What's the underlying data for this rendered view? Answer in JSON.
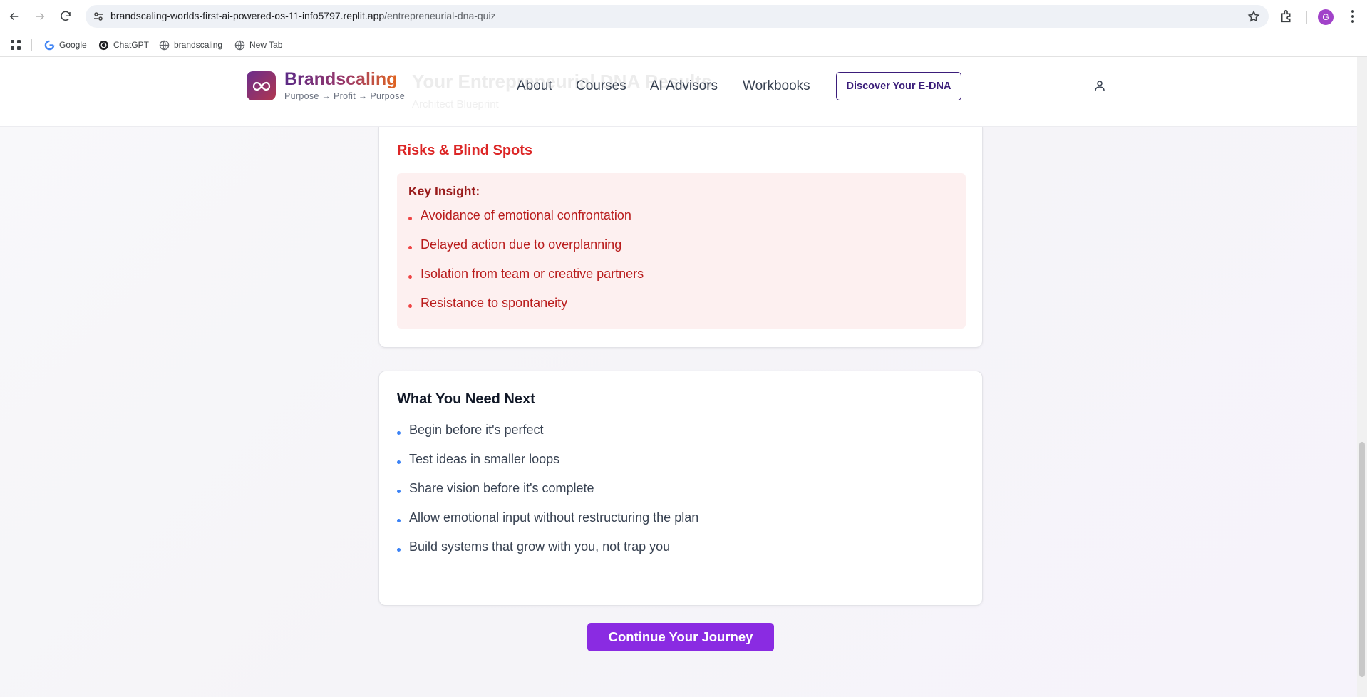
{
  "browser": {
    "url_domain": "brandscaling-worlds-first-ai-powered-os-11-info5797.replit.app",
    "url_path": "/entrepreneurial-dna-quiz",
    "profile_initial": "G",
    "bookmarks": [
      {
        "label": "Google",
        "icon": "google-icon"
      },
      {
        "label": "ChatGPT",
        "icon": "chatgpt-icon"
      },
      {
        "label": "brandscaling",
        "icon": "globe-icon"
      },
      {
        "label": "New Tab",
        "icon": "globe-icon"
      }
    ]
  },
  "header": {
    "brand_name": "Brandscaling",
    "tagline": "Purpose → Profit → Purpose",
    "nav": [
      {
        "label": "About"
      },
      {
        "label": "Courses"
      },
      {
        "label": "AI Advisors"
      },
      {
        "label": "Workbooks"
      }
    ],
    "cta_label": "Discover Your E-DNA",
    "ghost_title": "Your Entrepreneurial DNA Results",
    "ghost_subtitle": "Architect Blueprint"
  },
  "risks": {
    "title": "Risks & Blind Spots",
    "insight_label": "Key Insight:",
    "items": [
      "Avoidance of emotional confrontation",
      "Delayed action due to overplanning",
      "Isolation from team or creative partners",
      "Resistance to spontaneity"
    ]
  },
  "next": {
    "title": "What You Need Next",
    "items": [
      "Begin before it's perfect",
      "Test ideas in smaller loops",
      "Share vision before it's complete",
      "Allow emotional input without restructuring the plan",
      "Build systems that grow with you, not trap you"
    ]
  },
  "continue_label": "Continue Your Journey",
  "colors": {
    "accent": "#8a2be2",
    "risk_red": "#dc2626",
    "insight_bg": "#fdf0f0",
    "brand_dark": "#3b1d7a"
  }
}
